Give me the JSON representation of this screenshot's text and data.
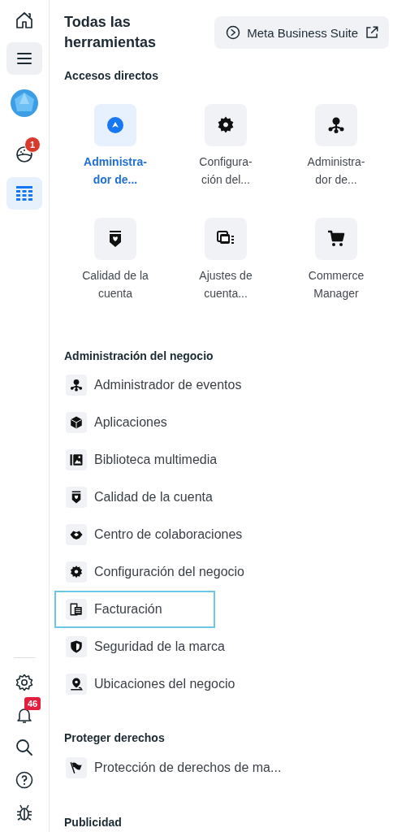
{
  "rail": {
    "top_items": [
      {
        "selected": false
      },
      {
        "selected": false,
        "pressed": true
      },
      {
        "selected": false
      },
      {
        "selected": false,
        "badge": "1"
      },
      {
        "selected": true
      }
    ],
    "bottom_items": [
      {
        "selected": false
      },
      {
        "selected": false,
        "badge": "46"
      },
      {
        "selected": false
      },
      {
        "selected": false
      },
      {
        "selected": false
      }
    ]
  },
  "header": {
    "title": "Todas las herramientas",
    "suite_button": "Meta Business Suite"
  },
  "shortcuts": {
    "heading": "Accesos directos",
    "items": [
      {
        "label": "Administra-dor de...",
        "selected": true
      },
      {
        "label": "Configura-ción del...",
        "selected": false
      },
      {
        "label": "Administra-dor de...",
        "selected": false
      },
      {
        "label": "Calidad de la cuenta",
        "selected": false
      },
      {
        "label": "Ajustes de cuenta...",
        "selected": false
      },
      {
        "label": "Commerce Manager",
        "selected": false
      }
    ]
  },
  "business": {
    "heading": "Administración del negocio",
    "items": [
      {
        "label": "Administrador de eventos",
        "highlighted": false
      },
      {
        "label": "Aplicaciones",
        "highlighted": false
      },
      {
        "label": "Biblioteca multimedia",
        "highlighted": false
      },
      {
        "label": "Calidad de la cuenta",
        "highlighted": false
      },
      {
        "label": "Centro de colaboraciones",
        "highlighted": false
      },
      {
        "label": "Configuración del negocio",
        "highlighted": false
      },
      {
        "label": "Facturación",
        "highlighted": true
      },
      {
        "label": "Seguridad de la marca",
        "highlighted": false
      },
      {
        "label": "Ubicaciones del negocio",
        "highlighted": false
      }
    ]
  },
  "rights": {
    "heading": "Proteger derechos",
    "items": [
      {
        "label": "Protección de derechos de ma...",
        "highlighted": false
      }
    ]
  },
  "advertising": {
    "heading": "Publicidad"
  }
}
